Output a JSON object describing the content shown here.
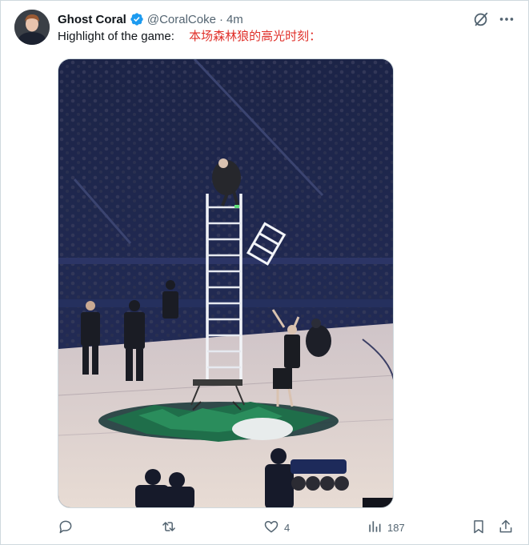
{
  "tweet": {
    "author_name": "Ghost Coral",
    "author_handle": "@CoralCoke",
    "separator": "·",
    "time": "4m",
    "text_en": "Highlight of the game:",
    "text_zh": "本场森林狼的高光时刻："
  },
  "actions": {
    "reply_count": "",
    "retweet_count": "",
    "like_count": "4",
    "views_count": "187"
  },
  "icons": {
    "verified": "verified-badge-icon",
    "grok": "grok-icon",
    "more": "more-icon",
    "reply": "reply-icon",
    "retweet": "retweet-icon",
    "like": "like-icon",
    "views": "views-icon",
    "bookmark": "bookmark-icon",
    "share": "share-icon"
  },
  "colors": {
    "accent_blue": "#1d9bf0",
    "annotation_red": "#e0302a",
    "text_secondary": "#536471"
  }
}
